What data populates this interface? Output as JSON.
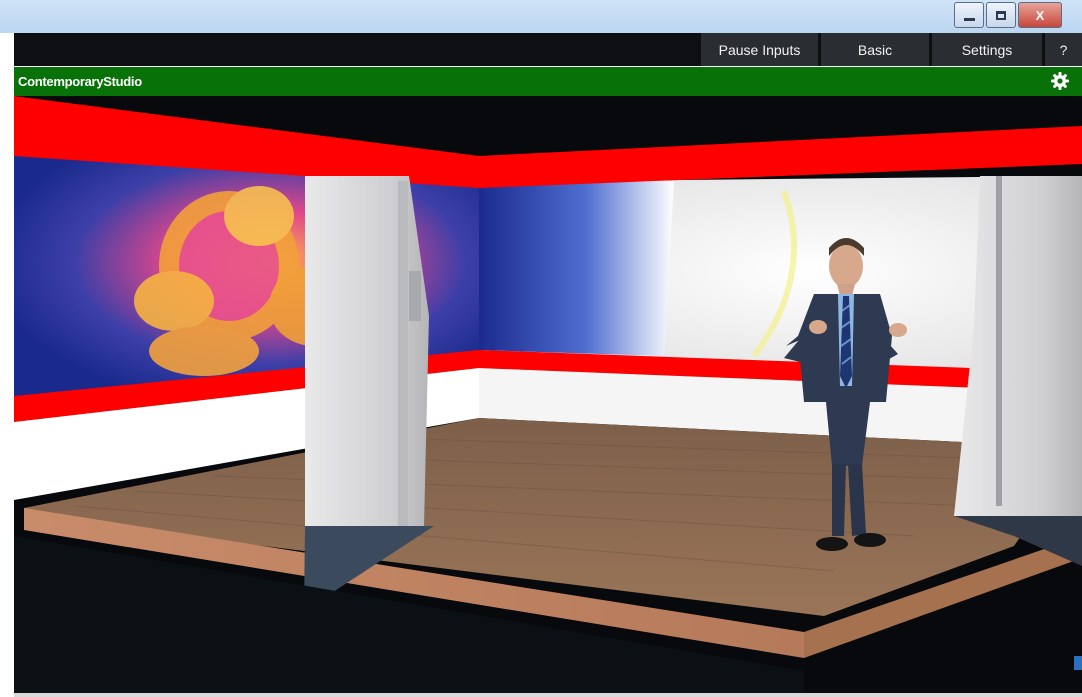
{
  "window": {
    "minimize_icon": "minimize-icon",
    "maximize_icon": "restore-icon",
    "close_label": "X"
  },
  "toolbar": {
    "pause_inputs_label": "Pause Inputs",
    "basic_label": "Basic",
    "settings_label": "Settings",
    "help_label": "?"
  },
  "scene": {
    "title": "ContemporaryStudio",
    "settings_icon": "gear-icon",
    "header_color": "#087208"
  },
  "preview": {
    "description_icons": [
      "studio-floor",
      "red-stripe",
      "presenter"
    ],
    "accent_red": "#ff0000",
    "floor_color": "#8a6a52"
  }
}
